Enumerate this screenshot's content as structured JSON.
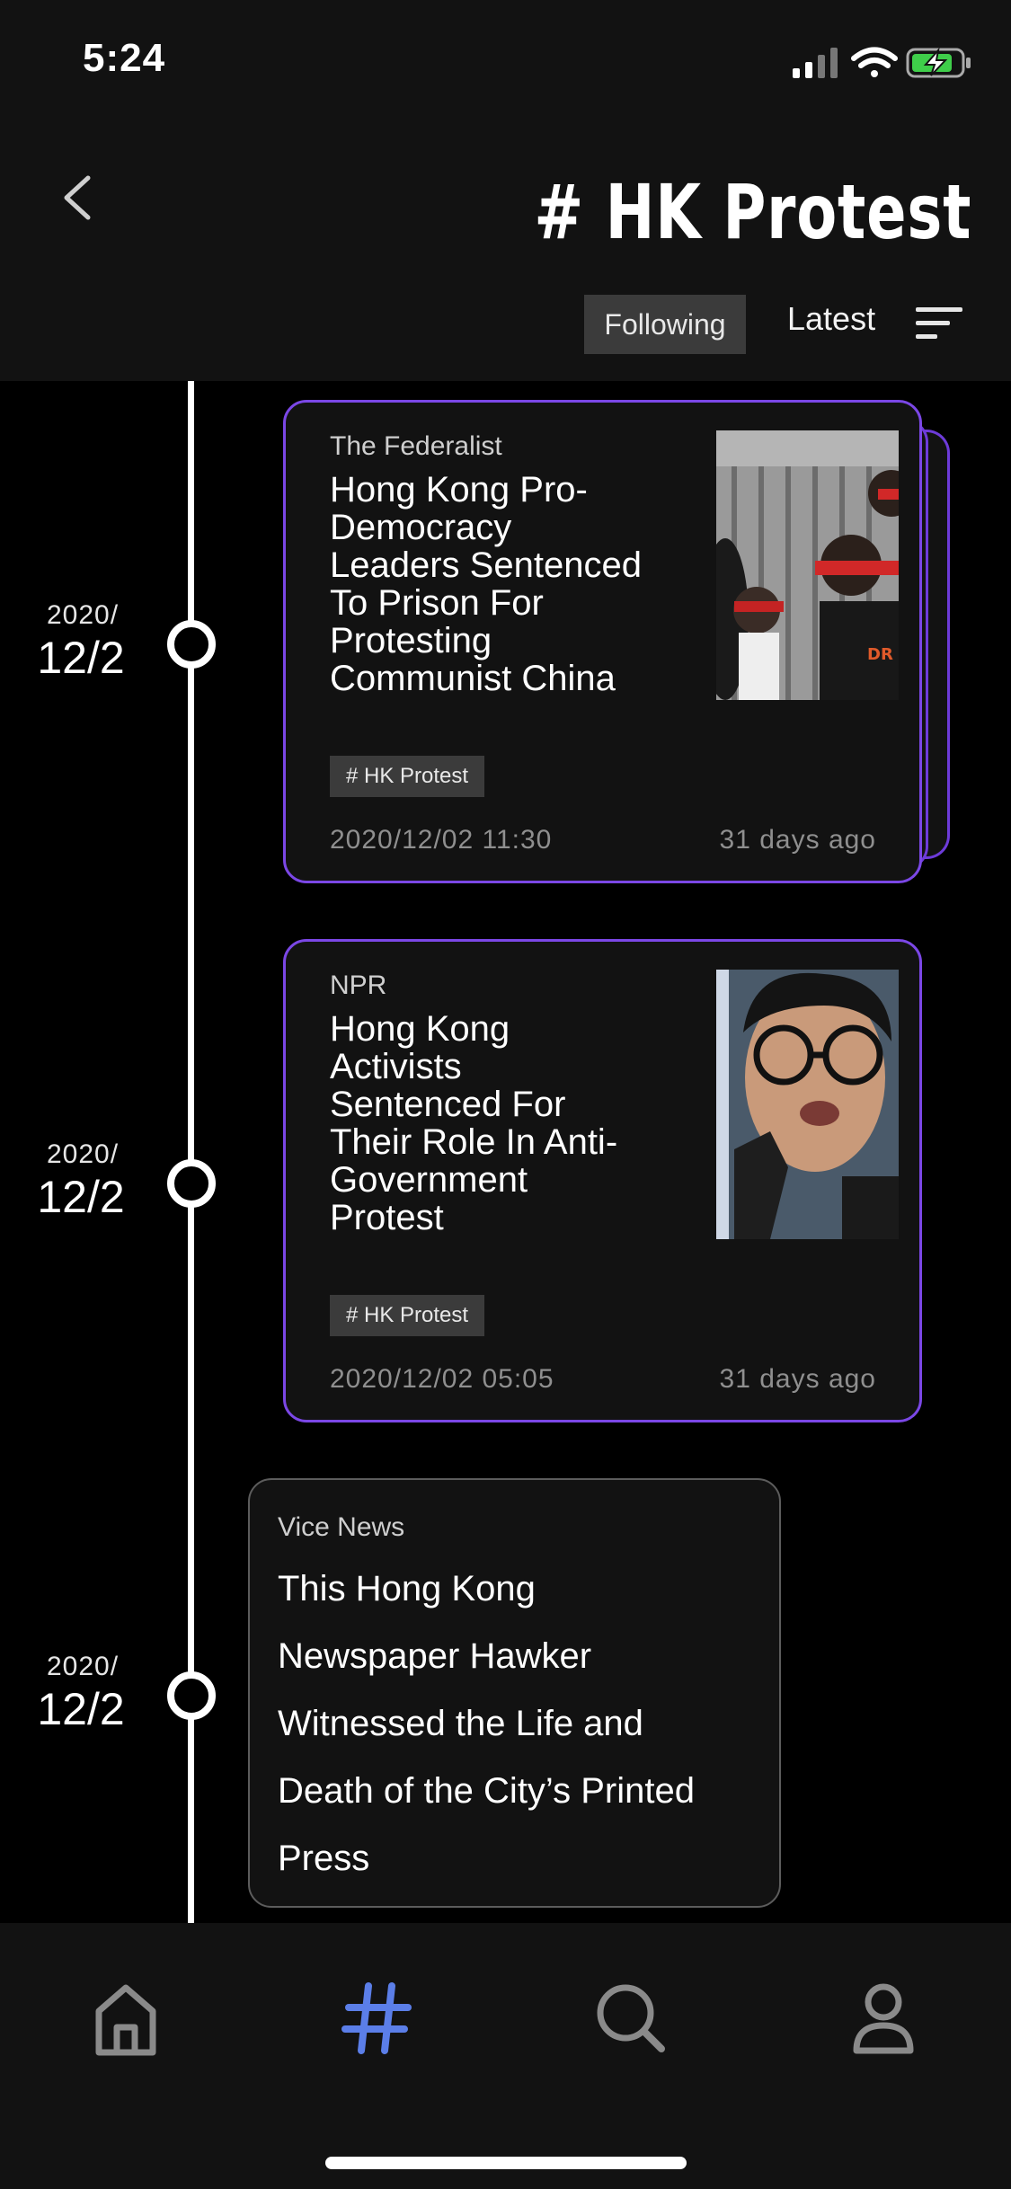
{
  "status_bar": {
    "time": "5:24"
  },
  "header": {
    "title": "# HK Protest",
    "following_label": "Following",
    "sort_label": "Latest"
  },
  "timeline": [
    {
      "year": "2020/",
      "day": "12/2",
      "source": "The Federalist",
      "headline_lines": [
        "Hong Kong Pro-",
        "Democracy",
        "Leaders Sentenced",
        "To Prison For",
        "Protesting",
        "Communist China"
      ],
      "tag": "# HK Protest",
      "timestamp": "2020/12/02 11:30",
      "ago": "31 days ago"
    },
    {
      "year": "2020/",
      "day": "12/2",
      "source": "NPR",
      "headline_lines": [
        "Hong Kong",
        "Activists",
        "Sentenced For",
        "Their Role In Anti-",
        "Government",
        "Protest"
      ],
      "tag": "# HK Protest",
      "timestamp": "2020/12/02 05:05",
      "ago": "31 days ago"
    },
    {
      "year": "2020/",
      "day": "12/2",
      "source": "Vice News",
      "headline_lines": [
        "This Hong Kong",
        "Newspaper Hawker",
        "Witnessed the Life and",
        "Death of the City’s Printed",
        "Press"
      ]
    }
  ],
  "tab_bar": {
    "items": [
      {
        "icon": "home-icon",
        "active": false
      },
      {
        "icon": "hashtag-icon",
        "active": true
      },
      {
        "icon": "search-icon",
        "active": false
      },
      {
        "icon": "profile-icon",
        "active": false
      }
    ],
    "active_color": "#5b7ee8",
    "inactive_color": "#8a8a8a"
  },
  "colors": {
    "card_border_accent": "#7b47e6",
    "background": "#000000"
  }
}
